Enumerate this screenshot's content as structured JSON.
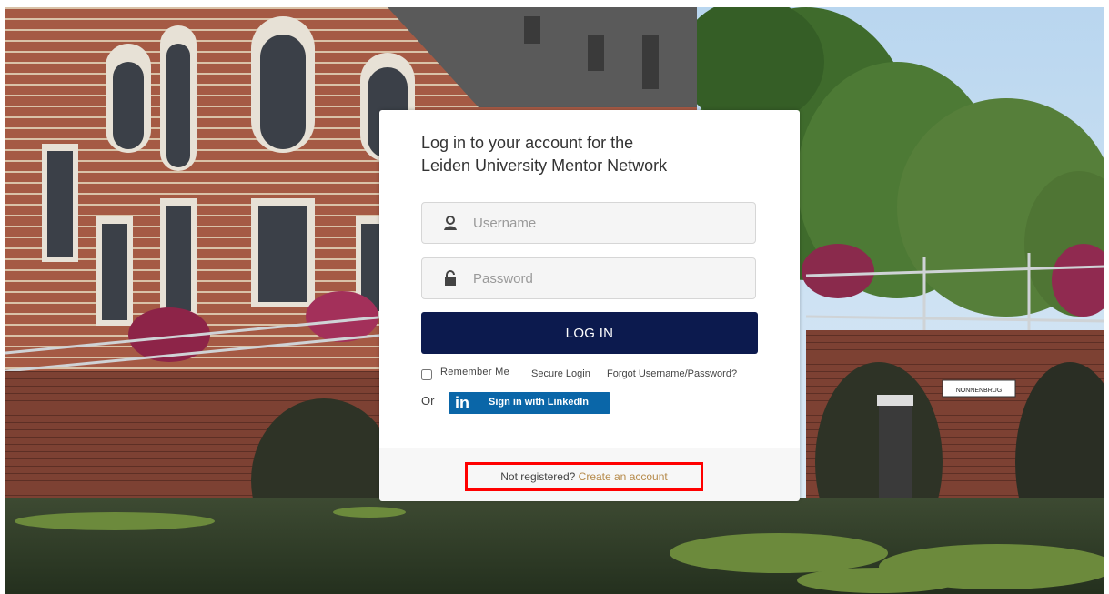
{
  "login": {
    "title_line1": "Log in to your account for the",
    "title_line2": "Leiden University Mentor Network",
    "username_placeholder": "Username",
    "password_placeholder": "Password",
    "login_button": "LOG IN",
    "remember_me": "Remember Me",
    "secure_login": "Secure Login",
    "forgot": "Forgot Username/Password?",
    "or": "Or",
    "linkedin_logo": "in",
    "linkedin_label": "Sign in with LinkedIn",
    "not_registered": "Not registered?",
    "create_account": "Create an account"
  },
  "background": {
    "sign_text": "NONNENBRUG"
  },
  "colors": {
    "login_button": "#0c1a4e",
    "linkedin": "#0a66a8",
    "create_link": "#b68a4a",
    "highlight_box": "#ff0000"
  }
}
